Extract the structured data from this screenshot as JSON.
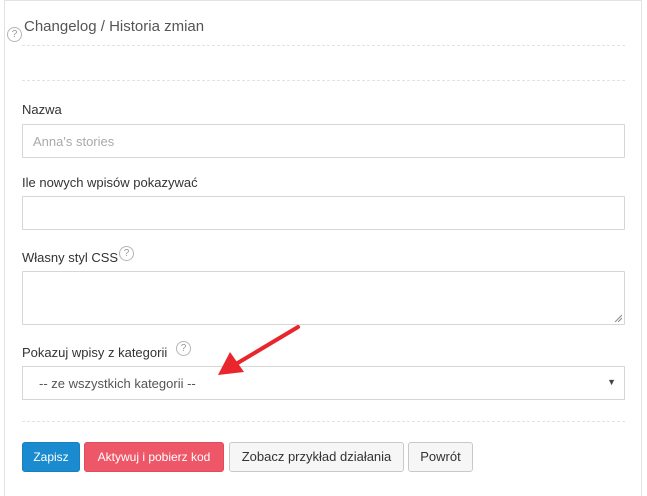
{
  "header": {
    "title": "Changelog / Historia zmian",
    "help_glyph": "?"
  },
  "form": {
    "name": {
      "label": "Nazwa",
      "placeholder": "Anna's stories",
      "value": ""
    },
    "count": {
      "label": "Ile nowych wpisów pokazywać",
      "value": ""
    },
    "css": {
      "label": "Własny styl CSS",
      "value": ""
    },
    "category": {
      "label": "Pokazuj wpisy z kategorii",
      "selected": "-- ze wszystkich kategorii --"
    }
  },
  "buttons": {
    "save": "Zapisz",
    "activate": "Aktywuj i pobierz kod",
    "example": "Zobacz przykład działania",
    "back": "Powrót"
  },
  "colors": {
    "primary": "#1b8bd0",
    "danger": "#ed5768",
    "annotation_arrow": "#e8262b"
  },
  "icons": {
    "help": "help-circle-icon",
    "caret": "caret-down-icon",
    "annotation": "red-arrow-icon"
  }
}
